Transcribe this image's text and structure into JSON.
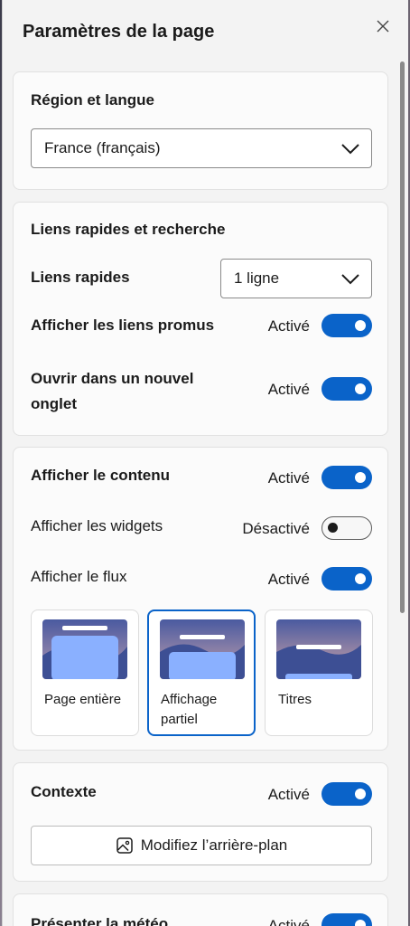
{
  "panel": {
    "title": "Paramètres de la page",
    "close_icon": "close-icon"
  },
  "region": {
    "heading": "Région et langue",
    "selected": "France (français)"
  },
  "quicklinks": {
    "heading": "Liens rapides et recherche",
    "links_label": "Liens rapides",
    "links_selected": "1 ligne",
    "promoted_label": "Afficher les liens promus",
    "promoted_status": "Activé",
    "newtab_label": "Ouvrir dans un nouvel onglet",
    "newtab_status": "Activé"
  },
  "content": {
    "heading": "Afficher le contenu",
    "heading_status": "Activé",
    "widgets_label": "Afficher les widgets",
    "widgets_status": "Désactivé",
    "feed_label": "Afficher le flux",
    "feed_status": "Activé",
    "layouts": [
      {
        "label": "Page entière",
        "selected": false
      },
      {
        "label": "Affichage partiel",
        "selected": true
      },
      {
        "label": "Titres",
        "selected": false
      }
    ]
  },
  "context": {
    "heading": "Contexte",
    "status": "Activé",
    "button_label": "Modifiez l’arrière-plan",
    "button_icon": "image-icon"
  },
  "weather": {
    "heading": "Présenter la météo",
    "status": "Activé"
  },
  "colors": {
    "accent": "#0a63c9",
    "panel_bg": "#f3f3f3",
    "card_bg": "#fbfbfb"
  }
}
